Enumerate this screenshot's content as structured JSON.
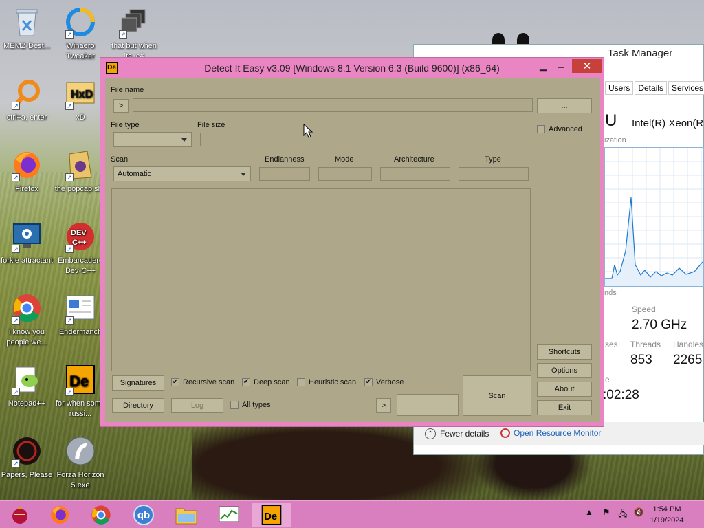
{
  "desktop": {
    "icons": [
      {
        "label": "MEMZ-Dest...",
        "icon": "recycle-bin"
      },
      {
        "label": "Winaero Tweaker",
        "icon": "winaero"
      },
      {
        "label": "that but when its .c#",
        "icon": "stacked-windows"
      },
      {
        "label": "ctrl+a, enter",
        "icon": "orange-magnifier"
      },
      {
        "label": "xD",
        "icon": "hxd"
      },
      {
        "label": "Firefox",
        "icon": "firefox"
      },
      {
        "label": "the popcap shit",
        "icon": "popcap"
      },
      {
        "label": "forkie attractant",
        "icon": "monitor-gear"
      },
      {
        "label": "Embarcadero Dev-C++",
        "icon": "devcpp"
      },
      {
        "label": "i know you people we...",
        "icon": "chrome"
      },
      {
        "label": "Endermanch",
        "icon": "document"
      },
      {
        "label": "Notepad++",
        "icon": "notepadpp"
      },
      {
        "label": "for when some russi...",
        "icon": "die"
      },
      {
        "label": "Papers, Please",
        "icon": "papers-please"
      },
      {
        "label": "Forza Horizon 5.exe",
        "icon": "flash"
      }
    ]
  },
  "task_manager": {
    "title": "Task Manager",
    "tabs": [
      "Users",
      "Details",
      "Services"
    ],
    "cpu_label": "U",
    "cpu_name": "Intel(R) Xeon(R",
    "util_label": "ization",
    "secs_label": "nds",
    "speed_label": "Speed",
    "speed_value": "2.70 GHz",
    "processes_label": "ses",
    "threads_label": "Threads",
    "threads_value": "853",
    "handles_label": "Handles",
    "handles_value": "2265",
    "uptime_label": "e",
    "uptime_value": ":02:28",
    "fewer_details": "Fewer details",
    "open_monitor": "Open Resource Monitor"
  },
  "die": {
    "title": "Detect It Easy v3.09 [Windows 8.1 Version 6.3 (Build 9600)] (x86_64)",
    "icon_text": "De",
    "file_name_label": "File name",
    "file_name_value": "",
    "go_btn": ">",
    "browse_btn": "...",
    "file_type_label": "File type",
    "file_type_value": "",
    "file_size_label": "File size",
    "file_size_value": "",
    "advanced_label": "Advanced",
    "scan_label": "Scan",
    "scan_value": "Automatic",
    "endianness_label": "Endianness",
    "mode_label": "Mode",
    "architecture_label": "Architecture",
    "type_label": "Type",
    "signatures_btn": "Signatures",
    "recursive_scan": "Recursive scan",
    "deep_scan": "Deep scan",
    "heuristic_scan": "Heuristic scan",
    "verbose": "Verbose",
    "directory_btn": "Directory",
    "log_btn": "Log",
    "all_types": "All types",
    "arrow_btn": ">",
    "scan_btn": "Scan",
    "shortcuts_btn": "Shortcuts",
    "options_btn": "Options",
    "about_btn": "About",
    "exit_btn": "Exit",
    "checks": {
      "advanced": false,
      "recursive": true,
      "deep": true,
      "heuristic": false,
      "verbose": true,
      "all_types": false
    }
  },
  "taskbar": {
    "apps": [
      "ornament",
      "firefox",
      "chrome",
      "qbittorrent",
      "file-explorer",
      "task-manager",
      "detect-it-easy"
    ],
    "qb_text": "qb",
    "clock_time": "1:54 PM",
    "clock_date": "1/19/2024"
  },
  "colors": {
    "die_frame": "#ea85c4",
    "die_body": "#aea78a",
    "taskbar": "#d97fc0",
    "close": "#c7403a"
  }
}
